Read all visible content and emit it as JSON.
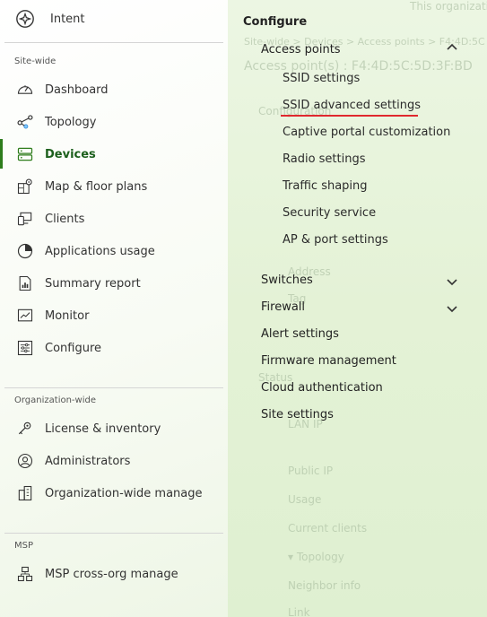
{
  "sidebar": {
    "intent_label": "Intent",
    "site_wide_label": "Site-wide",
    "site_items": [
      {
        "label": "Dashboard",
        "icon": "gauge-icon"
      },
      {
        "label": "Topology",
        "icon": "topology-icon"
      },
      {
        "label": "Devices",
        "icon": "devices-icon"
      },
      {
        "label": "Map & floor plans",
        "icon": "map-icon"
      },
      {
        "label": "Clients",
        "icon": "clients-icon"
      },
      {
        "label": "Applications usage",
        "icon": "pie-chart-icon"
      },
      {
        "label": "Summary report",
        "icon": "report-icon"
      },
      {
        "label": "Monitor",
        "icon": "monitor-icon"
      },
      {
        "label": "Configure",
        "icon": "sliders-icon"
      }
    ],
    "org_wide_label": "Organization-wide",
    "org_items": [
      {
        "label": "License & inventory",
        "icon": "key-icon"
      },
      {
        "label": "Administrators",
        "icon": "admin-icon"
      },
      {
        "label": "Organization-wide manage",
        "icon": "buildings-icon"
      }
    ],
    "msp_label": "MSP",
    "msp_items": [
      {
        "label": "MSP cross-org manage",
        "icon": "org-tree-icon"
      }
    ],
    "active_item": "Devices",
    "accent_color": "#2e7d1c"
  },
  "flyout": {
    "title": "Configure",
    "access_points_label": "Access points",
    "ap_items": [
      "SSID settings",
      "SSID advanced settings",
      "Captive portal customization",
      "Radio settings",
      "Traffic shaping",
      "Security service",
      "AP & port settings"
    ],
    "switches_label": "Switches",
    "firewall_label": "Firewall",
    "alert_settings_label": "Alert settings",
    "firmware_label": "Firmware management",
    "cloud_auth_label": "Cloud authentication",
    "site_settings_label": "Site settings",
    "highlight_color": "#e0282e"
  },
  "background": {
    "top_right": "This organizati",
    "breadcrumb": "Site-wide > Devices > Access points > F4:4D:5C",
    "heading": "Access point(s) : F4:4D:5C:5D:3F:BD",
    "config": "Configuration",
    "address": "Address",
    "tag": "Tag",
    "status": "Status",
    "lan_ip": "LAN IP",
    "public_ip": "Public IP",
    "usage": "Usage",
    "current_clients": "Current clients",
    "topology": "Topology",
    "neighbor_info": "Neighbor info",
    "link": "Link"
  }
}
